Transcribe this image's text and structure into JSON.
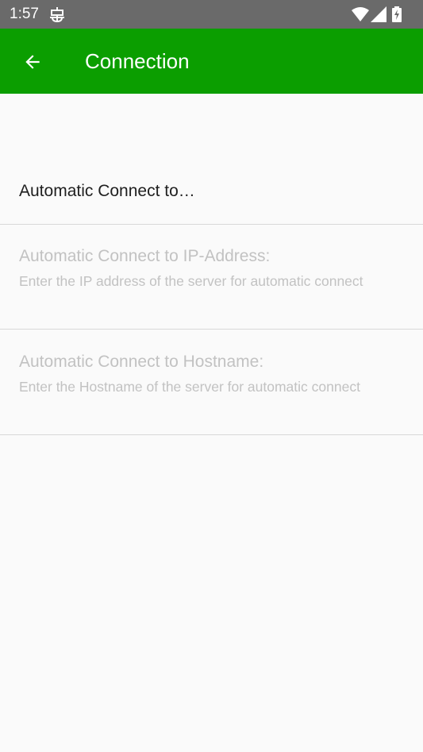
{
  "status_bar": {
    "time": "1:57",
    "icons": [
      "debug-icon",
      "wifi-icon",
      "signal-icon",
      "battery-charging-icon"
    ]
  },
  "app_bar": {
    "title": "Connection",
    "back_icon": "arrow-back-icon",
    "background": "#0b9e00"
  },
  "preferences": {
    "category_label": "Automatic Connect to…",
    "items": [
      {
        "title": "Automatic Connect to IP-Address:",
        "summary": "Enter the IP address of the server for automatic connect",
        "enabled": false
      },
      {
        "title": "Automatic Connect to Hostname:",
        "summary": "Enter the Hostname of the server for automatic connect",
        "enabled": false
      }
    ]
  }
}
